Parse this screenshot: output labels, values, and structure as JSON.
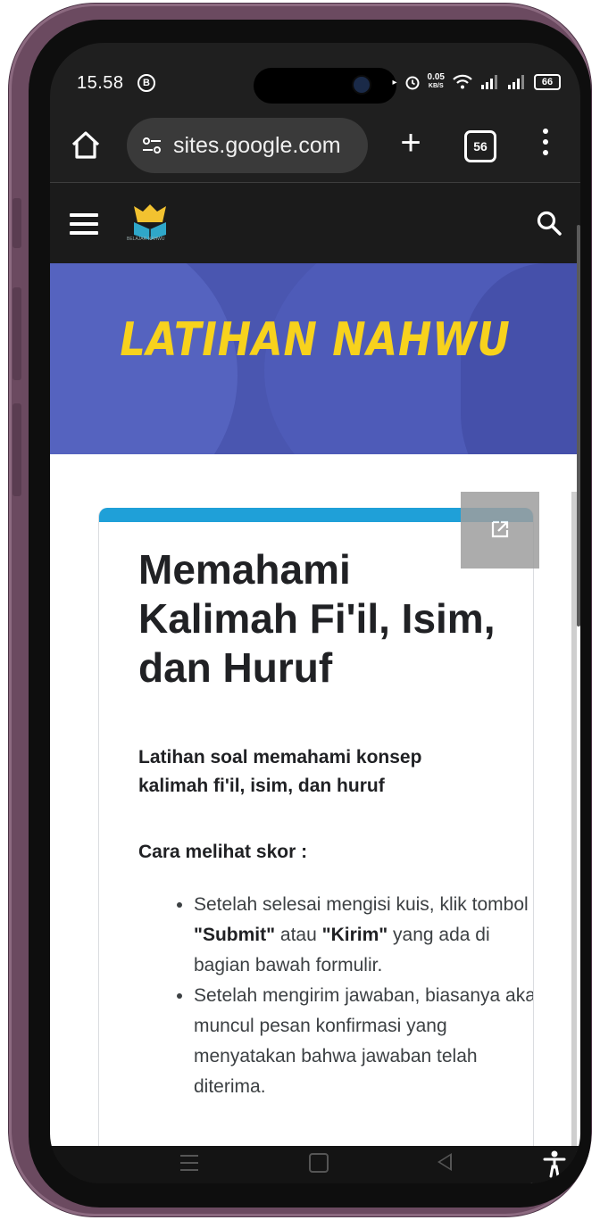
{
  "status_bar": {
    "time": "15.58",
    "notification_letter": "B",
    "net_speed": "0.05",
    "net_unit": "KB/S",
    "battery": "66"
  },
  "browser": {
    "url": "sites.google.com",
    "tab_count": "56"
  },
  "site": {
    "logo_caption": "BELAJAR NAHWU"
  },
  "hero": {
    "title": "LATIHAN NAHWU",
    "background_color": "#4a56b0",
    "title_color": "#f7d21d"
  },
  "card": {
    "title": "Memahami Kalimah Fi'il, Isim, dan Huruf",
    "subtitle": "Latihan soal memahami konsep kalimah fi'il, isim, dan huruf",
    "howto_heading": "Cara melihat skor :",
    "bullets": [
      {
        "part1": "Setelah selesai mengisi kuis, klik tombol ",
        "bold1": "\"Submit\"",
        "part2": " atau ",
        "bold2": "\"Kirim\"",
        "part3": " yang ada di bagian bawah formulir."
      },
      {
        "text": "Setelah mengirim jawaban, biasanya akan muncul pesan konfirmasi yang menyatakan bahwa jawaban telah diterima."
      }
    ],
    "accent_color": "#1fa0d8"
  }
}
